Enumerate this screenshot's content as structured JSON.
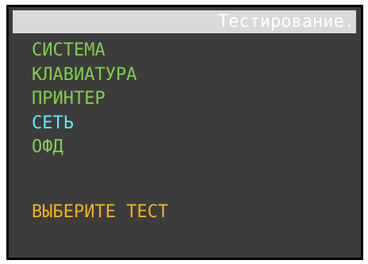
{
  "header": {
    "title": "Тестирование.",
    "title_color": "#ffffff",
    "bar_color": "#d9d9d9"
  },
  "screen": {
    "background": "#3c3c3c",
    "border": "#000000"
  },
  "menu": {
    "items": [
      {
        "label": "СИСТЕМА",
        "color": "#7ecf4a",
        "selected": false
      },
      {
        "label": "КЛАВИАТУРА",
        "color": "#7ecf4a",
        "selected": false
      },
      {
        "label": "ПРИНТЕР",
        "color": "#7ecf4a",
        "selected": false
      },
      {
        "label": "СЕТЬ",
        "color": "#5fe8f5",
        "selected": true
      },
      {
        "label": "ОФД",
        "color": "#7ecf4a",
        "selected": false
      }
    ]
  },
  "prompt": {
    "text": "ВЫБЕРИТЕ ТЕСТ",
    "color": "#f0b21b"
  }
}
